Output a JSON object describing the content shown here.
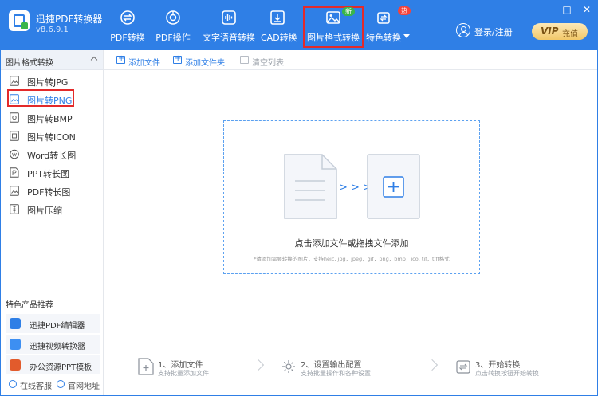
{
  "app": {
    "title": "迅捷PDF转换器",
    "version": "v8.6.9.1"
  },
  "nav": {
    "items": [
      {
        "label": "PDF转换",
        "icon": "pdf-convert-icon"
      },
      {
        "label": "PDF操作",
        "icon": "pdf-operate-icon"
      },
      {
        "label": "文字语音转换",
        "icon": "voice-wave-icon"
      },
      {
        "label": "CAD转换",
        "icon": "cad-icon"
      },
      {
        "label": "图片格式转换",
        "icon": "image-icon",
        "active": true,
        "badge": "新"
      },
      {
        "label": "特色转换",
        "icon": "special-convert-icon",
        "badge": "热"
      }
    ]
  },
  "user": {
    "login_label": "登录/注册",
    "vip_mark": "VIP",
    "vip_label": "充值"
  },
  "window_controls": {
    "minimize": "—",
    "maximize": "□",
    "close": "✕"
  },
  "sidebar": {
    "header": "图片格式转换",
    "items": [
      {
        "label": "图片转JPG",
        "icon": "image-jpg-icon"
      },
      {
        "label": "图片转PNG",
        "icon": "image-png-icon",
        "active": true
      },
      {
        "label": "图片转BMP",
        "icon": "image-bmp-icon"
      },
      {
        "label": "图片转ICON",
        "icon": "image-icon-icon"
      },
      {
        "label": "Word转长图",
        "icon": "word-long-image-icon"
      },
      {
        "label": "PPT转长图",
        "icon": "ppt-long-image-icon"
      },
      {
        "label": "PDF转长图",
        "icon": "pdf-long-image-icon"
      },
      {
        "label": "图片压缩",
        "icon": "image-compress-icon"
      }
    ],
    "recommend_title": "特色产品推荐",
    "recommend": [
      {
        "label": "迅捷PDF编辑器",
        "color": "#2f7fe6"
      },
      {
        "label": "迅捷视频转换器",
        "color": "#3d8ff2"
      },
      {
        "label": "办公资源PPT模板",
        "color": "#e25b2c"
      }
    ],
    "footer": {
      "online_service": "在线客服",
      "official_site": "官网地址"
    }
  },
  "toolbar": {
    "add_file": "添加文件",
    "add_folder": "添加文件夹",
    "clear_list": "清空列表"
  },
  "dropzone": {
    "main_text": "点击添加文件或拖拽文件添加",
    "sub_text": "*请添加需要转换的图片，支持heic, jpg，jpeg，gif，png，bmp，ico, tif，tiff格式",
    "arrows": "> > >"
  },
  "steps": [
    {
      "title": "1、添加文件",
      "desc": "支持批量添加文件"
    },
    {
      "title": "2、设置输出配置",
      "desc": "支持批量操作和各种设置"
    },
    {
      "title": "3、开始转换",
      "desc": "点击转换按钮开始转换"
    }
  ],
  "colors": {
    "brand": "#2f7fe6",
    "highlight_outline": "#e32a2a",
    "badge_new": "#39b54a",
    "badge_hot": "#f5433c"
  }
}
